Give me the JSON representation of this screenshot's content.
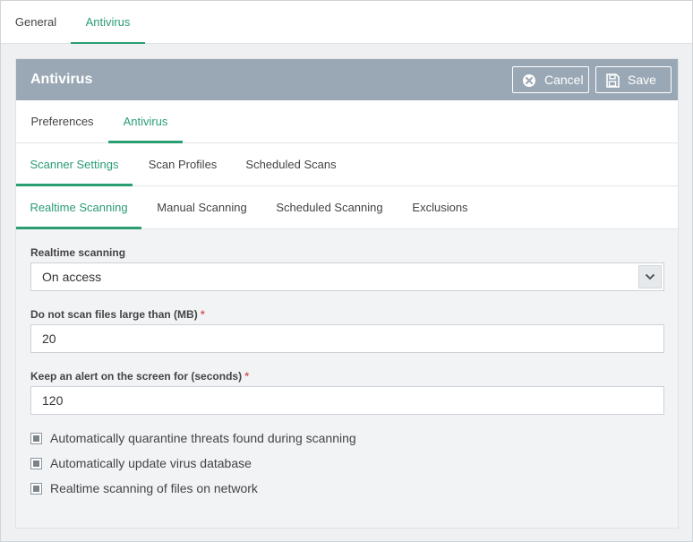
{
  "top_tabs": [
    {
      "label": "General",
      "active": false
    },
    {
      "label": "Antivirus",
      "active": true
    }
  ],
  "panel": {
    "title": "Antivirus",
    "cancel_label": "Cancel",
    "save_label": "Save"
  },
  "section_tabs": [
    {
      "label": "Preferences",
      "active": false
    },
    {
      "label": "Antivirus",
      "active": true
    }
  ],
  "scanner_tabs": [
    {
      "label": "Scanner Settings",
      "active": true
    },
    {
      "label": "Scan Profiles",
      "active": false
    },
    {
      "label": "Scheduled Scans",
      "active": false
    }
  ],
  "scanning_tabs": [
    {
      "label": "Realtime Scanning",
      "active": true
    },
    {
      "label": "Manual Scanning",
      "active": false
    },
    {
      "label": "Scheduled Scanning",
      "active": false
    },
    {
      "label": "Exclusions",
      "active": false
    }
  ],
  "form": {
    "realtime_label": "Realtime scanning",
    "realtime_value": "On access",
    "max_size_label": "Do not scan files large than (MB)",
    "max_size_value": "20",
    "alert_label": "Keep an alert on the screen for (seconds)",
    "alert_value": "120",
    "required_mark": "*",
    "checkboxes": [
      {
        "label": "Automatically quarantine threats found during scanning",
        "checked": true
      },
      {
        "label": "Automatically update virus database",
        "checked": true
      },
      {
        "label": "Realtime scanning of files on network",
        "checked": true
      }
    ]
  },
  "colors": {
    "accent": "#2a9d73",
    "header": "#9aa8b5",
    "required": "#d9534f"
  }
}
